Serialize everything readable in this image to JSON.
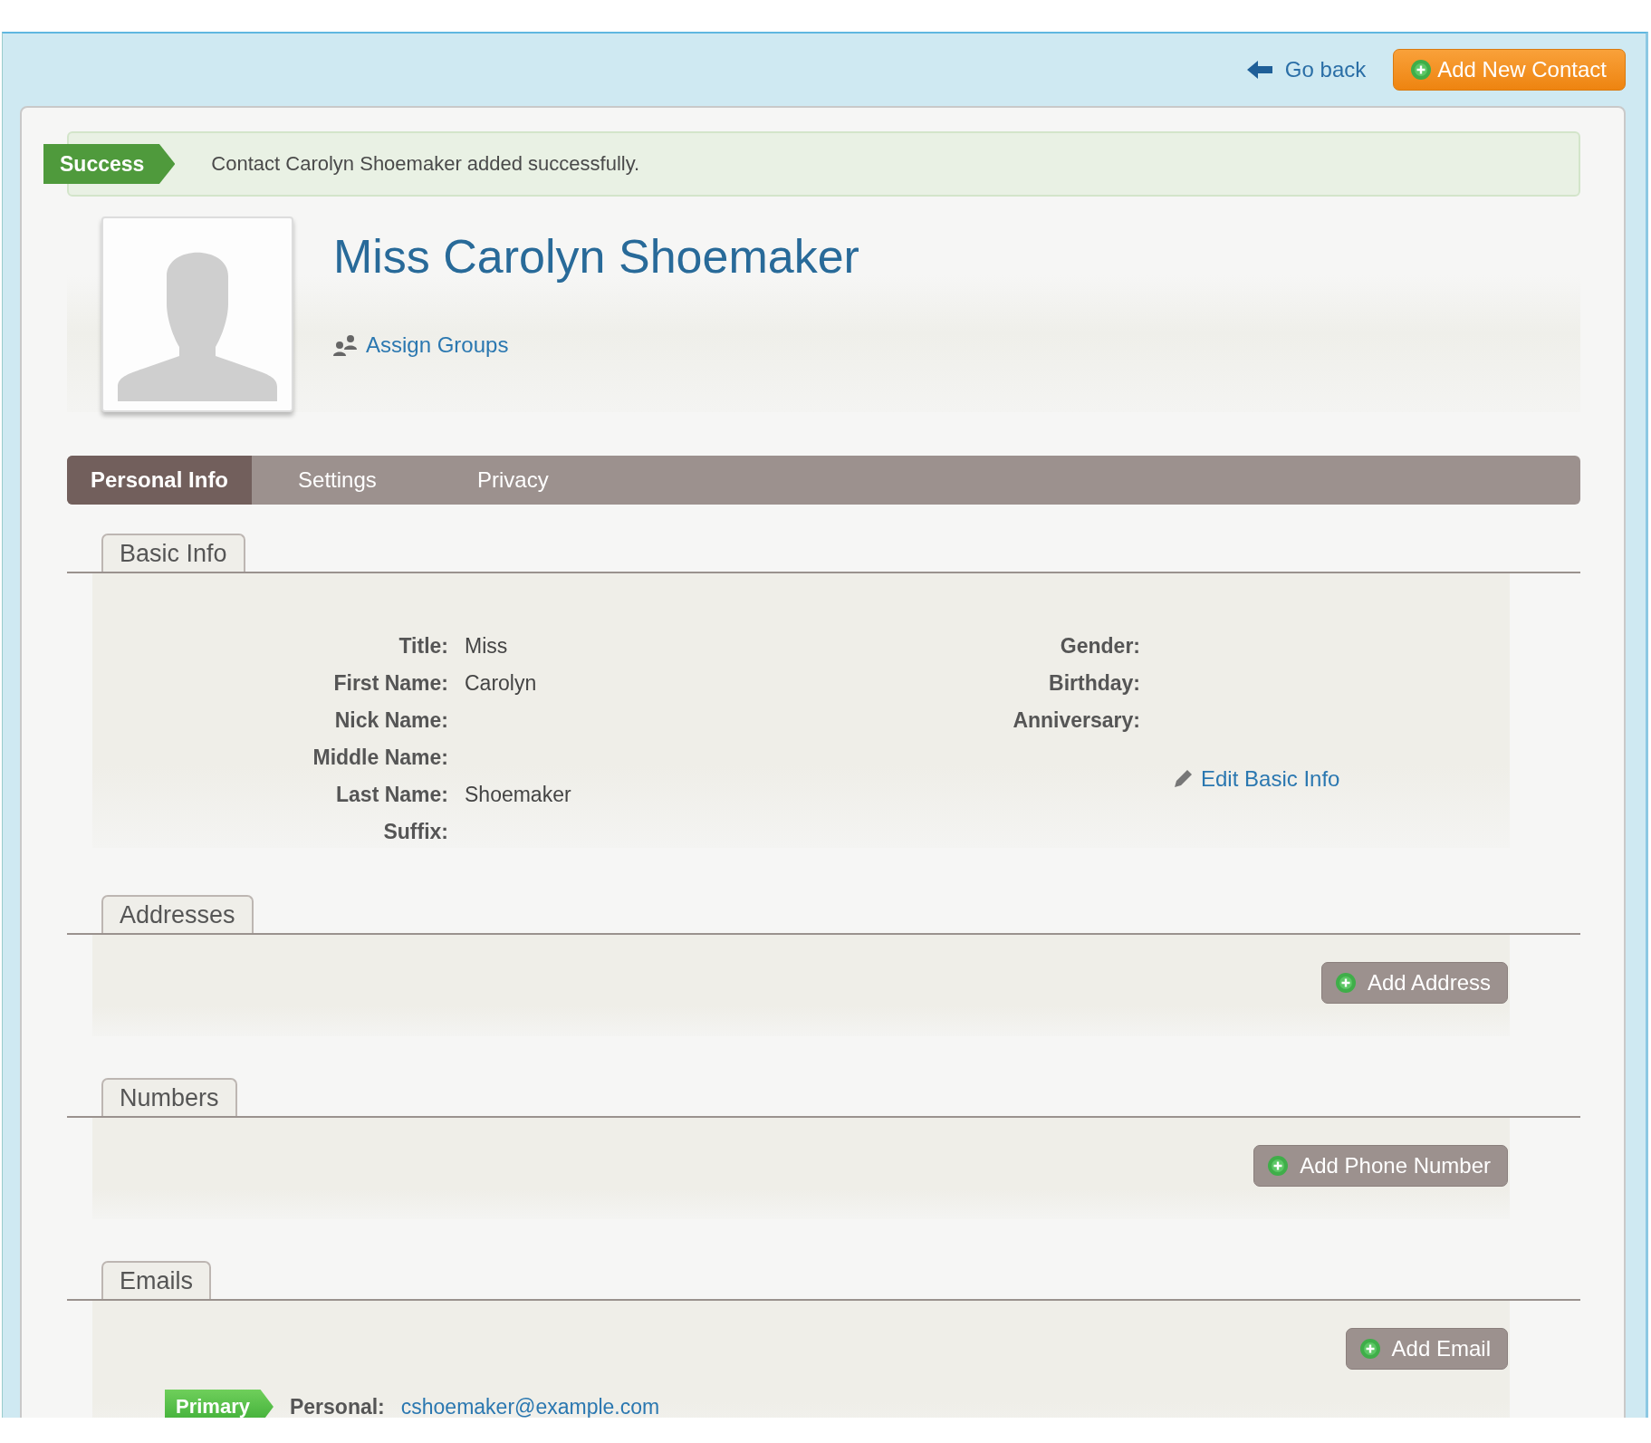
{
  "header": {
    "back_link": "Go back",
    "add_button": "Add New Contact"
  },
  "alert": {
    "badge": "Success",
    "message": "Contact Carolyn Shoemaker added successfully."
  },
  "contact": {
    "name": "Miss Carolyn Shoemaker",
    "assign_groups": "Assign Groups"
  },
  "tabs": [
    {
      "label": "Personal Info",
      "selected": true
    },
    {
      "label": "Settings",
      "selected": false
    },
    {
      "label": "Privacy",
      "selected": false
    }
  ],
  "basic_info": {
    "title": "Basic Info",
    "left_fields": [
      {
        "label": "Title:",
        "value": "Miss"
      },
      {
        "label": "First Name:",
        "value": "Carolyn"
      },
      {
        "label": "Nick Name:"
      },
      {
        "label": "Middle Name:"
      },
      {
        "label": "Last Name:",
        "value": "Shoemaker"
      },
      {
        "label": "Suffix:"
      }
    ],
    "right_fields": [
      {
        "label": "Gender:"
      },
      {
        "label": "Birthday:"
      },
      {
        "label": "Anniversary:"
      }
    ],
    "edit_link": "Edit Basic Info"
  },
  "sections": [
    {
      "title": "Addresses",
      "button": "Add Address"
    },
    {
      "title": "Numbers",
      "button": "Add Phone Number"
    },
    {
      "title": "Emails",
      "button": "Add Email",
      "emails": [
        {
          "badge": "Primary",
          "label": "Personal:",
          "address": "cshoemaker@example.com"
        }
      ]
    }
  ]
}
